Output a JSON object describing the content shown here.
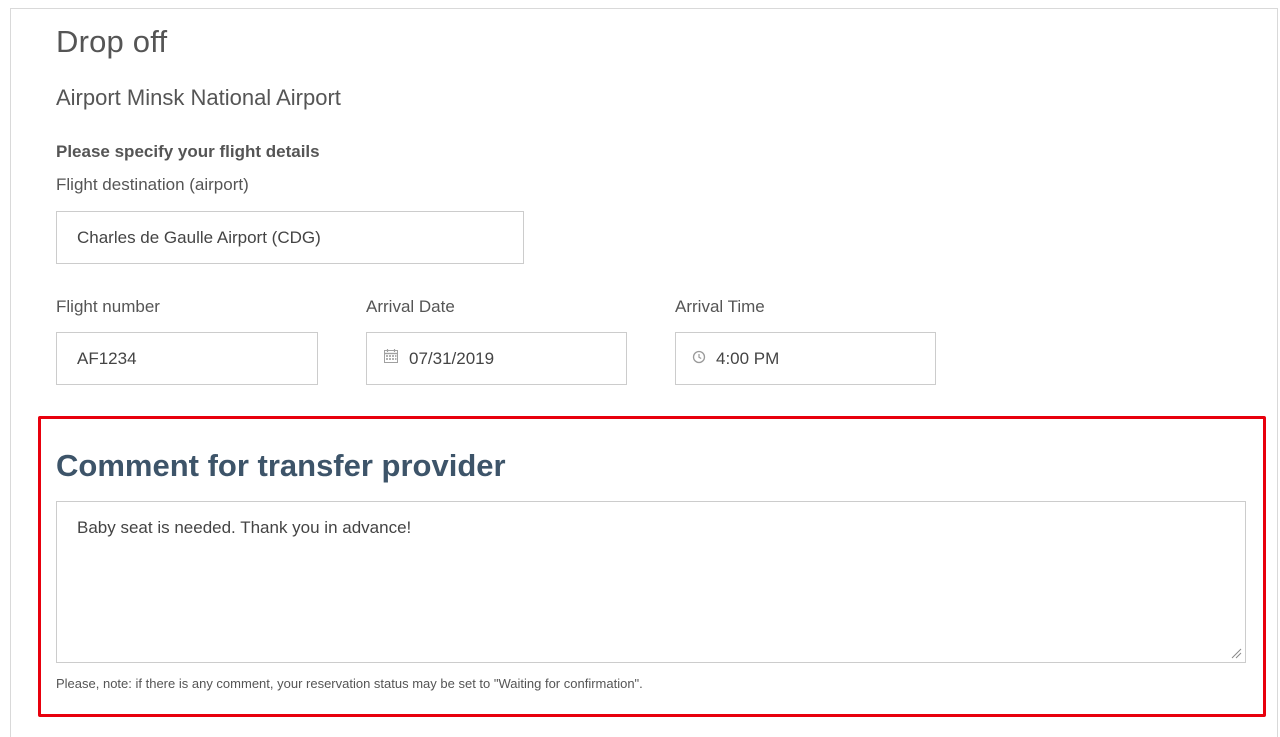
{
  "section": {
    "title": "Drop off",
    "airport": "Airport Minsk National Airport",
    "flight_heading": "Please specify your flight details"
  },
  "fields": {
    "destination": {
      "label": "Flight destination (airport)",
      "value": "Charles de Gaulle Airport (CDG)"
    },
    "flight_number": {
      "label": "Flight number",
      "value": "AF1234"
    },
    "arrival_date": {
      "label": "Arrival Date",
      "value": "07/31/2019",
      "icon": "calendar-icon"
    },
    "arrival_time": {
      "label": "Arrival Time",
      "value": "4:00 PM",
      "icon": "clock-icon"
    }
  },
  "comment": {
    "heading": "Comment for transfer provider",
    "value": "Baby seat  is needed. Thank you in advance!",
    "note": "Please, note: if there is any comment, your reservation status may be set to \"Waiting for confirmation\"."
  },
  "colors": {
    "highlight_border": "#e8000d",
    "heading_color": "#3d5469"
  }
}
